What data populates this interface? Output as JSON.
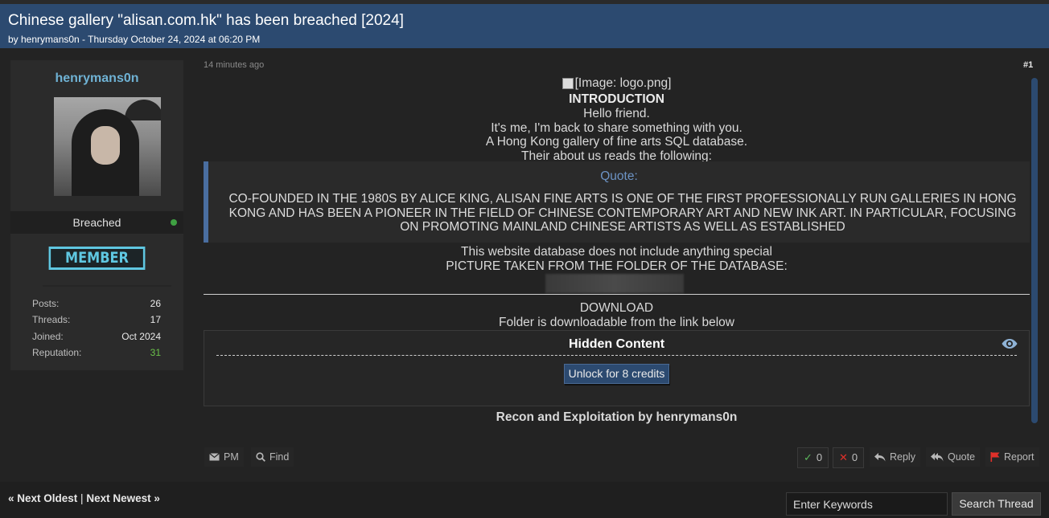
{
  "thread": {
    "title": "Chinese gallery \"alisan.com.hk\" has been breached [2024]",
    "meta": "by henrymans0n - Thursday October 24, 2024 at 06:20 PM"
  },
  "user": {
    "name": "henrymans0n",
    "status": "Breached",
    "rank": "MEMBER",
    "stats": [
      {
        "label": "Posts:",
        "value": "26"
      },
      {
        "label": "Threads:",
        "value": "17"
      },
      {
        "label": "Joined:",
        "value": "Oct 2024"
      },
      {
        "label": "Reputation:",
        "value": "31"
      }
    ]
  },
  "post": {
    "time": "14 minutes ago",
    "number": "#1",
    "logo_alt": "[Image: logo.png]",
    "intro_heading": "INTRODUCTION",
    "intro_lines": [
      "Hello friend.",
      "It's me, I'm back to share something with you.",
      "A Hong Kong gallery of fine arts SQL database.",
      "Their about us reads the following:"
    ],
    "quote_label": "Quote:",
    "quote_text": "CO-FOUNDED IN THE 1980S BY ALICE KING, ALISAN FINE ARTS IS ONE OF THE FIRST PROFESSIONALLY RUN GALLERIES IN HONG KONG AND HAS BEEN A PIONEER IN THE FIELD OF CHINESE CONTEMPORARY ART AND NEW INK ART. IN PARTICULAR, FOCUSING ON PROMOTING MAINLAND CHINESE ARTISTS AS WELL AS ESTABLISHED",
    "note_bold": "This website database does not include anything special",
    "note_line": "PICTURE TAKEN FROM THE FOLDER OF THE DATABASE:",
    "download_heading": "DOWNLOAD",
    "download_line": "Folder is downloadable from the link below",
    "hidden_title": "Hidden Content",
    "unlock_label": "Unlock for 8 credits",
    "signature": "Recon and Exploitation by henrymans0n"
  },
  "actions": {
    "pm": "PM",
    "find": "Find",
    "upvotes": "0",
    "downvotes": "0",
    "reply": "Reply",
    "quote": "Quote",
    "report": "Report"
  },
  "footer": {
    "next_oldest": "« Next Oldest",
    "separator": "|",
    "next_newest": "Next Newest »",
    "search_placeholder": "Enter Keywords",
    "search_button": "Search Thread"
  },
  "colors": {
    "header_blue": "#2c4a70",
    "username": "#6fb2d4",
    "rank_accent": "#5fc7e1",
    "quote_label": "#6c93c4",
    "online_green": "#3fa142",
    "reputation_green": "#6bc24a",
    "report_red": "#e0302a"
  }
}
